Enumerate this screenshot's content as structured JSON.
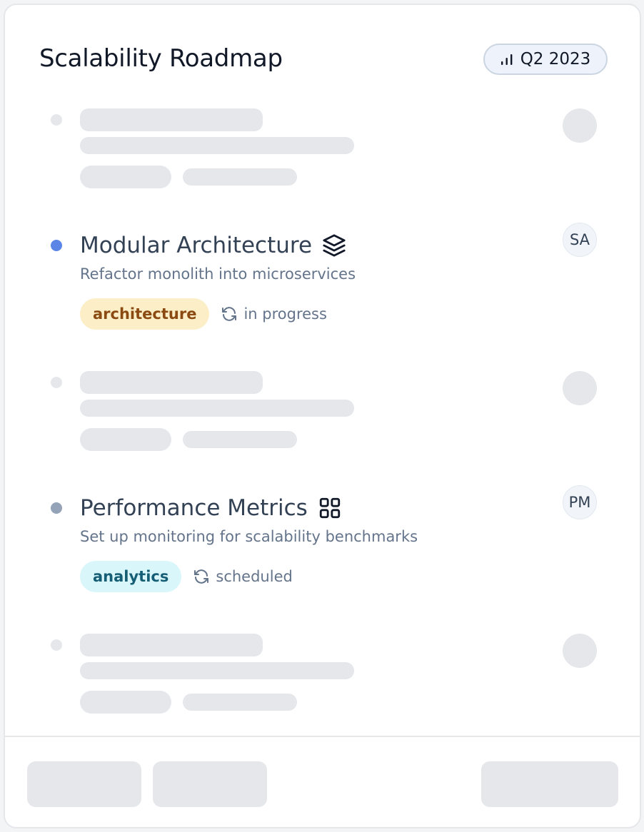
{
  "card": {
    "title": "Scalability Roadmap",
    "period": "Q2 2023",
    "period_icon": "signal-bars-icon"
  },
  "items": [
    {
      "title": "Modular Architecture",
      "icon": "layers-icon",
      "description": "Refactor monolith into microservices",
      "tag": "architecture",
      "status": "in progress",
      "status_icon": "refresh-icon",
      "assignee": "SA",
      "dot_color": "#5b86e5",
      "tag_bg": "#fcefc7",
      "tag_color": "#8a4a12"
    },
    {
      "title": "Performance Metrics",
      "icon": "grid-icon",
      "description": "Set up monitoring for scalability benchmarks",
      "tag": "analytics",
      "status": "scheduled",
      "status_icon": "refresh-icon",
      "assignee": "PM",
      "dot_color": "#94a3b8",
      "tag_bg": "#d9f7fb",
      "tag_color": "#155e75"
    }
  ],
  "colors": {
    "skeleton": "#e5e7eb",
    "card_border": "#e5e7eb",
    "badge_bg": "#eef2fb"
  }
}
